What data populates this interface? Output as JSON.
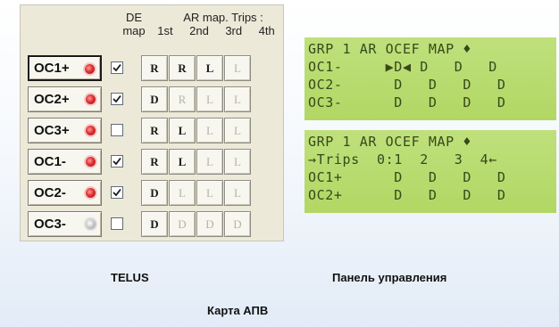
{
  "panel": {
    "header": {
      "de": "DE",
      "map": "map",
      "ar": "AR map. Trips :",
      "trips": [
        "1st",
        "2nd",
        "3rd",
        "4th"
      ]
    },
    "rows": [
      {
        "label": "OC1+",
        "led": "on",
        "checked": true,
        "trips": [
          {
            "v": "R",
            "on": true
          },
          {
            "v": "R",
            "on": true
          },
          {
            "v": "L",
            "on": true
          },
          {
            "v": "L",
            "on": false
          }
        ],
        "selected": true
      },
      {
        "label": "OC2+",
        "led": "on",
        "checked": true,
        "trips": [
          {
            "v": "D",
            "on": true
          },
          {
            "v": "R",
            "on": false
          },
          {
            "v": "L",
            "on": false
          },
          {
            "v": "L",
            "on": false
          }
        ]
      },
      {
        "label": "OC3+",
        "led": "on",
        "checked": false,
        "trips": [
          {
            "v": "R",
            "on": true
          },
          {
            "v": "L",
            "on": true
          },
          {
            "v": "L",
            "on": false
          },
          {
            "v": "L",
            "on": false
          }
        ]
      },
      {
        "label": "OC1-",
        "led": "on",
        "checked": true,
        "trips": [
          {
            "v": "R",
            "on": true
          },
          {
            "v": "L",
            "on": true
          },
          {
            "v": "L",
            "on": false
          },
          {
            "v": "L",
            "on": false
          }
        ]
      },
      {
        "label": "OC2-",
        "led": "on",
        "checked": true,
        "trips": [
          {
            "v": "D",
            "on": true
          },
          {
            "v": "L",
            "on": false
          },
          {
            "v": "L",
            "on": false
          },
          {
            "v": "L",
            "on": false
          }
        ]
      },
      {
        "label": "OC3-",
        "led": "off",
        "checked": false,
        "trips": [
          {
            "v": "D",
            "on": true
          },
          {
            "v": "D",
            "on": false
          },
          {
            "v": "D",
            "on": false
          },
          {
            "v": "D",
            "on": false
          }
        ]
      }
    ]
  },
  "lcd1": {
    "lines": [
      "GRP 1 AR OCEF MAP ♦",
      "OC1-     ▶D◀ D   D   D",
      "OC2-      D   D   D   D",
      "OC3-      D   D   D   D"
    ]
  },
  "lcd2": {
    "lines": [
      "GRP 1 AR OCEF MAP ♦",
      "→Trips  0:1  2   3  4←",
      "OC1+      D   D   D   D",
      "OC2+      D   D   D   D"
    ]
  },
  "captions": {
    "telus": "TELUS",
    "panel": "Панель управления",
    "map": "Карта АПВ"
  },
  "colors": {
    "panel_bg": "#ece9d8",
    "lcd_bg": "#b9dc6f",
    "lcd_text": "#37491a",
    "led_on": "#e03030",
    "led_off": "#c8c8c8"
  }
}
